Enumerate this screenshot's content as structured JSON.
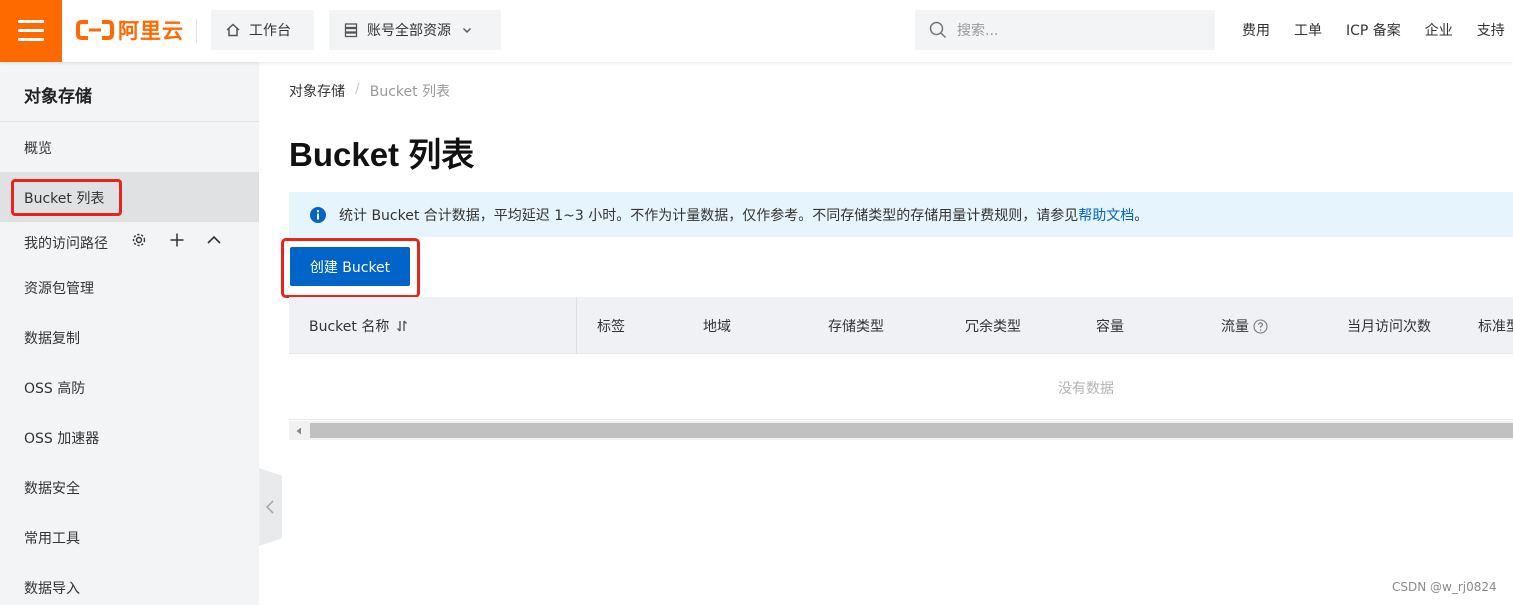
{
  "header": {
    "logo_text": "阿里云",
    "workbench_label": "工作台",
    "resources_label": "账号全部资源",
    "search_placeholder": "搜索...",
    "links": [
      "费用",
      "工单",
      "ICP 备案",
      "企业",
      "支持"
    ]
  },
  "sidebar": {
    "title": "对象存储",
    "items": [
      {
        "label": "概览"
      },
      {
        "label": "Bucket 列表",
        "active": true
      },
      {
        "label": "我的访问路径"
      },
      {
        "label": "资源包管理"
      },
      {
        "label": "数据复制"
      },
      {
        "label": "OSS 高防"
      },
      {
        "label": "OSS 加速器"
      },
      {
        "label": "数据安全"
      },
      {
        "label": "常用工具"
      },
      {
        "label": "数据导入"
      }
    ]
  },
  "breadcrumb": {
    "root": "对象存储",
    "current": "Bucket 列表"
  },
  "page_title": "Bucket 列表",
  "notice": {
    "text": "统计 Bucket 合计数据，平均延迟 1~3 小时。不作为计量数据，仅作参考。不同存储类型的存储用量计费规则，请参见",
    "link": "帮助文档",
    "end": "。"
  },
  "create_button": "创建 Bucket",
  "table": {
    "columns": [
      "Bucket 名称",
      "标签",
      "地域",
      "存储类型",
      "冗余类型",
      "容量",
      "流量",
      "当月访问次数",
      "标准型"
    ],
    "empty_text": "没有数据"
  },
  "watermark": "CSDN @w_rj0824",
  "colors": {
    "brand_orange": "#ff6a00",
    "primary_blue": "#0064c8",
    "highlight_red": "#e8251c"
  }
}
